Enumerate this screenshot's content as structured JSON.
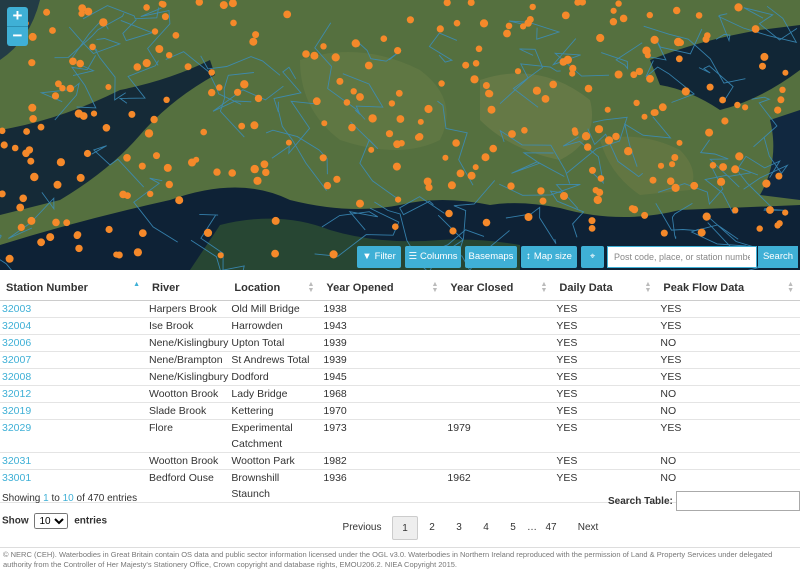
{
  "map": {
    "zoom_in": "+",
    "zoom_out": "−",
    "toolbar": {
      "filter": "Filter",
      "columns": "Columns",
      "basemaps": "Basemaps",
      "mapsize": "Map size",
      "search_placeholder": "Post code, place, or station number",
      "search": "Search"
    },
    "colors": {
      "land": "#4f6b3c",
      "sea": "#0e2236",
      "river": "#3b8fbf",
      "station": "#f5892a",
      "accent": "#3fb0d6"
    }
  },
  "table": {
    "headers": [
      "Station Number",
      "River",
      "Location",
      "Year Opened",
      "Year Closed",
      "Daily Data",
      "Peak Flow Data"
    ],
    "rows": [
      {
        "sn": "32003",
        "river": "Harpers Brook",
        "loc": "Old Mill Bridge",
        "opened": "1938",
        "closed": "",
        "daily": "YES",
        "peak": "YES"
      },
      {
        "sn": "32004",
        "river": "Ise Brook",
        "loc": "Harrowden",
        "opened": "1943",
        "closed": "",
        "daily": "YES",
        "peak": "YES"
      },
      {
        "sn": "32006",
        "river": "Nene/Kislingbury",
        "loc": "Upton Total",
        "opened": "1939",
        "closed": "",
        "daily": "YES",
        "peak": "NO"
      },
      {
        "sn": "32007",
        "river": "Nene/Brampton",
        "loc": "St Andrews Total",
        "opened": "1939",
        "closed": "",
        "daily": "YES",
        "peak": "YES"
      },
      {
        "sn": "32008",
        "river": "Nene/Kislingbury",
        "loc": "Dodford",
        "opened": "1945",
        "closed": "",
        "daily": "YES",
        "peak": "YES"
      },
      {
        "sn": "32012",
        "river": "Wootton Brook",
        "loc": "Lady Bridge",
        "opened": "1968",
        "closed": "",
        "daily": "YES",
        "peak": "NO"
      },
      {
        "sn": "32019",
        "river": "Slade Brook",
        "loc": "Kettering",
        "opened": "1970",
        "closed": "",
        "daily": "YES",
        "peak": "NO"
      },
      {
        "sn": "32029",
        "river": "Flore",
        "loc": "Experimental Catchment",
        "opened": "1973",
        "closed": "1979",
        "daily": "YES",
        "peak": "YES"
      },
      {
        "sn": "32031",
        "river": "Wootton Brook",
        "loc": "Wootton Park",
        "opened": "1982",
        "closed": "",
        "daily": "YES",
        "peak": "NO"
      },
      {
        "sn": "33001",
        "river": "Bedford Ouse",
        "loc": "Brownshill Staunch",
        "opened": "1936",
        "closed": "1962",
        "daily": "YES",
        "peak": "NO"
      }
    ]
  },
  "info": {
    "prefix": "Showing ",
    "start": "1",
    "mid": " to ",
    "end": "10",
    "suffix": " of 470 entries"
  },
  "show": {
    "label": "Show",
    "value": "10",
    "suffix": "entries"
  },
  "search_table": {
    "label": "Search Table:"
  },
  "pagination": {
    "previous": "Previous",
    "pages": [
      "1",
      "2",
      "3",
      "4",
      "5"
    ],
    "ellipsis": "…",
    "last": "47",
    "next": "Next"
  },
  "footer": "© NERC (CEH). Waterbodies in Great Britain contain OS data and public sector information licensed under the OGL v3.0. Waterbodies in Northern Ireland reproduced with the permission of Land & Property Services under delegated authority from the Controller of Her Majesty's Stationery Office, Crown copyright and database rights, EMOU206.2. NIEA Copyright 2015."
}
